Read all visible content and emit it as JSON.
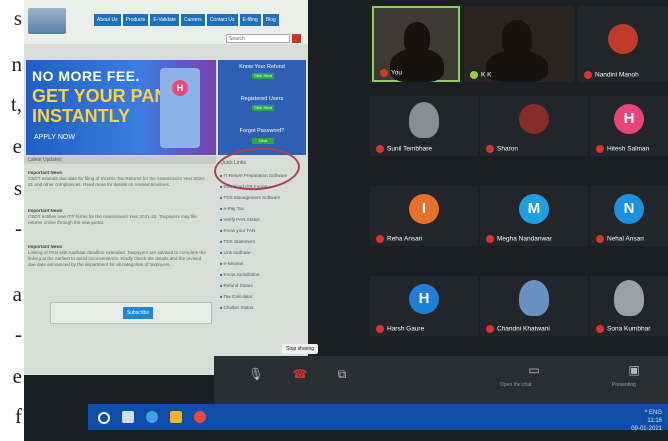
{
  "page_margin_text": [
    "s",
    "n",
    "t,",
    "e",
    "s",
    "-",
    "a",
    "-",
    "e",
    "f"
  ],
  "website": {
    "nav_items": [
      "About Us",
      "Products",
      "E-Validate",
      "Careers",
      "Contact Us",
      "E-filing",
      "Blog"
    ],
    "search_placeholder": "Search",
    "banner": {
      "line1": "NO MORE FEE.",
      "line2": "GET YOUR PAN",
      "line3": "INSTANTLY",
      "cta": "APPLY NOW",
      "logo_letter": "H"
    },
    "side_panel": {
      "title1": "Know Your Refund",
      "btn1": "Click Here",
      "title2": "Registered Users",
      "btn2": "Click Here",
      "title3": "Forgot Password?",
      "btn3": "Click"
    },
    "latest_news_label": "Latest Updates",
    "news": [
      {
        "head": "Important News",
        "body": "CBDT extends due date for filing of Income Tax Returns for the Assessment Year 2020-21 and other compliances. Read more for details on revised timelines."
      },
      {
        "head": "Important News",
        "body": "CBDT notifies new ITR forms for the Assessment Year 2021-22. Taxpayers may file returns online through the new portal."
      },
      {
        "head": "Important News",
        "body": "Linking of PAN with Aadhaar deadline extended. Taxpayers are advised to complete the linking at the earliest to avoid inconvenience. Kindly check the details and the revised due date announced by the department for all categories of taxpayers."
      }
    ],
    "subscribe_button": "Subscribe",
    "quick_links_label": "Quick Links",
    "quick_links": [
      "IT Return Preparation Software",
      "Download ITR Forms",
      "TDS Management Software",
      "e-Pay Tax",
      "Verify PAN Status",
      "Know your TAN",
      "TDS Statement",
      "Link Aadhaar",
      "e-Nivaran",
      "Know Jurisdiction",
      "Refund Status",
      "Tax Calculator",
      "Challan Status"
    ]
  },
  "zoom": {
    "self_label": "You",
    "tiles": [
      {
        "name": "K K",
        "type": "photo",
        "color": "#5a5f66"
      },
      {
        "name": "Nandini Manoh",
        "type": "avatar",
        "letter": "",
        "color": "#c0392b"
      },
      {
        "name": "Sunil Tembhare",
        "type": "photo",
        "color": "#8a8d91"
      },
      {
        "name": "Sharon",
        "type": "avatar",
        "letter": "",
        "color": "#b0312b"
      },
      {
        "name": "Hitesh Salman",
        "type": "avatar",
        "letter": "H",
        "color": "#e8457a"
      },
      {
        "name": "Reha Ansari",
        "type": "avatar",
        "letter": "I",
        "color": "#e8712a"
      },
      {
        "name": "Megha Nandanwar",
        "type": "avatar",
        "letter": "M",
        "color": "#1f9fe0"
      },
      {
        "name": "Nehal Ansari",
        "type": "avatar",
        "letter": "N",
        "color": "#1f8fe0"
      },
      {
        "name": "Harsh Gaure",
        "type": "avatar",
        "letter": "H",
        "color": "#1f7fd8"
      },
      {
        "name": "Chandni Khatwani",
        "type": "photo",
        "color": "#6a8fc0"
      },
      {
        "name": "Sona Kumbhar",
        "type": "photo",
        "color": "#9aa0a6"
      }
    ],
    "tooltip": "Stop sharing",
    "chat_label": "Open the chat",
    "sharing_label": "Presenting",
    "colors": {
      "accent_green": "#8fd14f",
      "mic_red": "#d9342b"
    }
  },
  "taskbar": {
    "time": "11:16",
    "date": "09-01-2021",
    "tray_text": "^ ENG"
  }
}
